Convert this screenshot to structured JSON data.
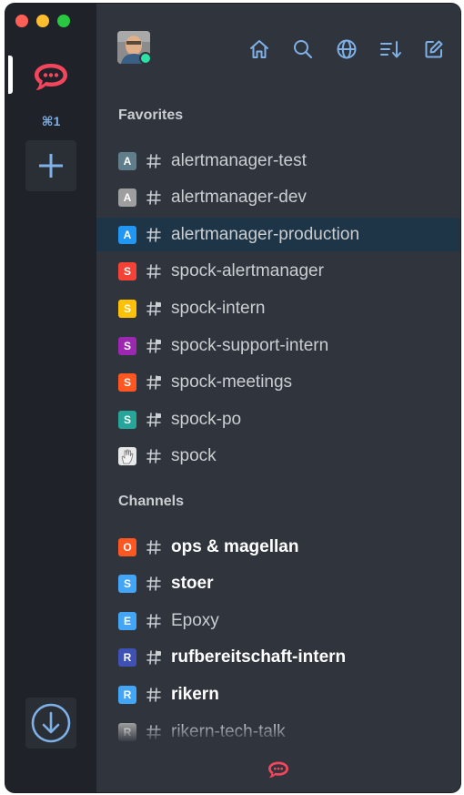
{
  "rail": {
    "shortcut": "⌘1",
    "colors": {
      "brand": "#f5455c",
      "accent": "#7fb0e6"
    }
  },
  "header": {
    "status_color": "#2de0a5",
    "toolbar": [
      {
        "name": "home-icon",
        "icon": "home-icon"
      },
      {
        "name": "search-icon",
        "icon": "search-icon"
      },
      {
        "name": "directory-icon",
        "icon": "globe-icon"
      },
      {
        "name": "sort-icon",
        "icon": "sort-icon"
      },
      {
        "name": "create-new-icon",
        "icon": "edit-icon"
      }
    ]
  },
  "sections": {
    "favorites": "Favorites",
    "channels": "Channels"
  },
  "favorites": [
    {
      "initial": "A",
      "color": "#607d8b",
      "name": "alertmanager-test",
      "type": "public",
      "bold": false
    },
    {
      "initial": "A",
      "color": "#9e9e9e",
      "name": "alertmanager-dev",
      "type": "public",
      "bold": false
    },
    {
      "initial": "A",
      "color": "#2196f3",
      "name": "alertmanager-production",
      "type": "public",
      "bold": false,
      "active": true
    },
    {
      "initial": "S",
      "color": "#f44336",
      "name": "spock-alertmanager",
      "type": "public",
      "bold": false
    },
    {
      "initial": "S",
      "color": "#ffc107",
      "name": "spock-intern",
      "type": "private",
      "bold": false
    },
    {
      "initial": "S",
      "color": "#9c27b0",
      "name": "spock-support-intern",
      "type": "private",
      "bold": false
    },
    {
      "initial": "S",
      "color": "#ff5722",
      "name": "spock-meetings",
      "type": "private",
      "bold": false
    },
    {
      "initial": "S",
      "color": "#26a69a",
      "name": "spock-po",
      "type": "private",
      "bold": false
    },
    {
      "initial": "",
      "color": "#e8e8e8",
      "name": "spock",
      "type": "public",
      "bold": false,
      "hand": true
    }
  ],
  "channels": [
    {
      "initial": "O",
      "color": "#ff5722",
      "name": "ops & magellan",
      "type": "public",
      "bold": true
    },
    {
      "initial": "S",
      "color": "#42a5f5",
      "name": "stoer",
      "type": "public",
      "bold": true
    },
    {
      "initial": "E",
      "color": "#42a5f5",
      "name": "Epoxy",
      "type": "public",
      "bold": false
    },
    {
      "initial": "R",
      "color": "#3f51b5",
      "name": "rufbereitschaft-intern",
      "type": "private",
      "bold": true
    },
    {
      "initial": "R",
      "color": "#42a5f5",
      "name": "rikern",
      "type": "public",
      "bold": true
    },
    {
      "initial": "R",
      "color": "#9e9e9e",
      "name": "rikern-tech-talk",
      "type": "public",
      "bold": false
    }
  ]
}
